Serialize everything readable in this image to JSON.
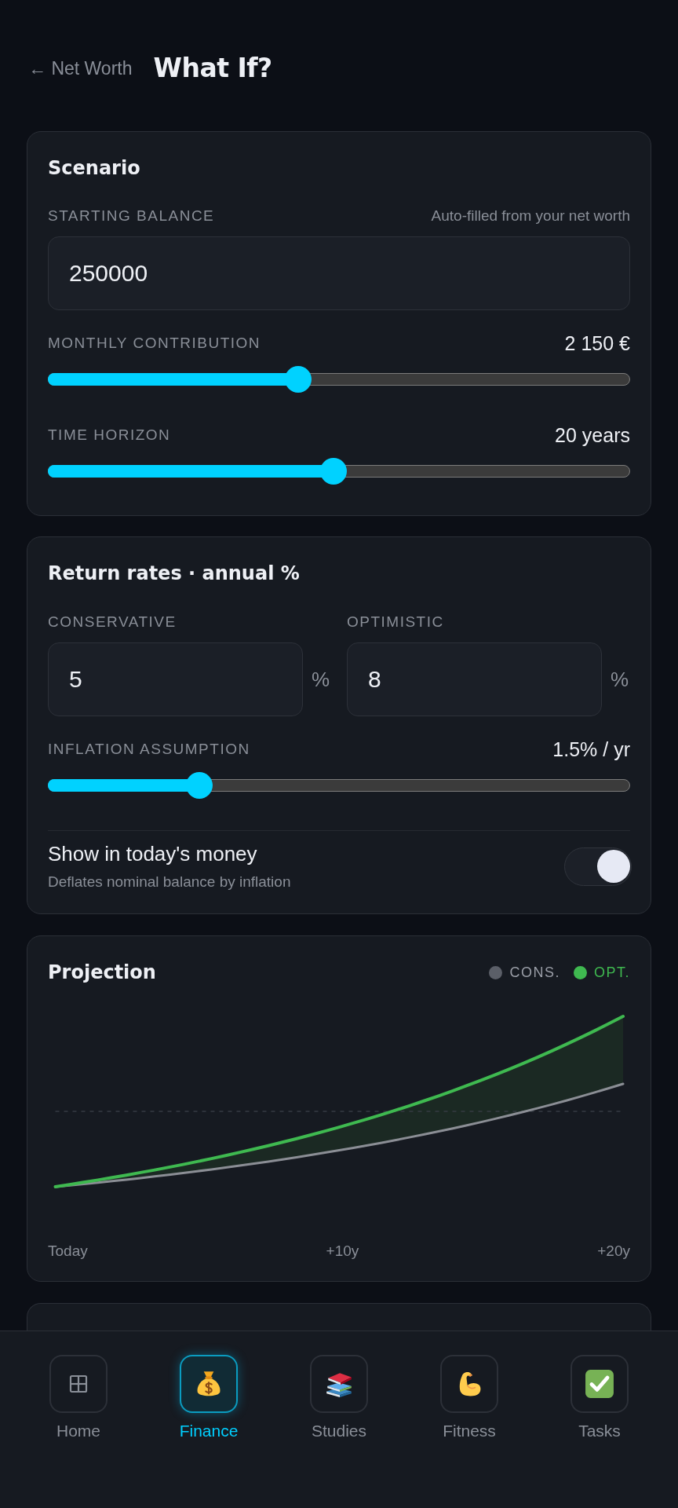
{
  "header": {
    "back_link": "← Net Worth",
    "title": "What If?"
  },
  "scenario": {
    "title": "Scenario",
    "starting_balance": {
      "label": "STARTING BALANCE",
      "note": "Auto-filled from your net worth",
      "value": "250000"
    },
    "sliders": [
      {
        "label": "MONTHLY CONTRIBUTION",
        "reading": "2 150 €",
        "level": 0.43
      },
      {
        "label": "TIME HORIZON",
        "reading": "20 years",
        "level": 0.49
      }
    ]
  },
  "return_rates": {
    "title": "Return rates · annual %",
    "rates": [
      {
        "label": "CONSERVATIVE",
        "value": "5",
        "unit": "%"
      },
      {
        "label": "OPTIMISTIC",
        "value": "8",
        "unit": "%"
      }
    ],
    "inflation": {
      "label": "INFLATION ASSUMPTION",
      "reading": "1.5% / yr",
      "level": 0.26
    },
    "todays_money": {
      "label": "Show in today's money",
      "description": "Deflates nominal balance by inflation",
      "on": true
    }
  },
  "projection": {
    "title": "Projection",
    "legend": [
      {
        "label": "CONS.",
        "color": "#5b5f68",
        "highlighted": false
      },
      {
        "label": "OPT.",
        "color": "#3fb950",
        "highlighted": true
      }
    ],
    "x_labels": [
      "Today",
      "+10y",
      "+20y"
    ]
  },
  "bottom_nav": [
    {
      "label": "Home",
      "selected": false
    },
    {
      "label": "Finance",
      "selected": true
    },
    {
      "label": "Studies",
      "selected": false
    },
    {
      "label": "Fitness",
      "selected": false
    },
    {
      "label": "Tasks",
      "selected": false
    }
  ]
}
